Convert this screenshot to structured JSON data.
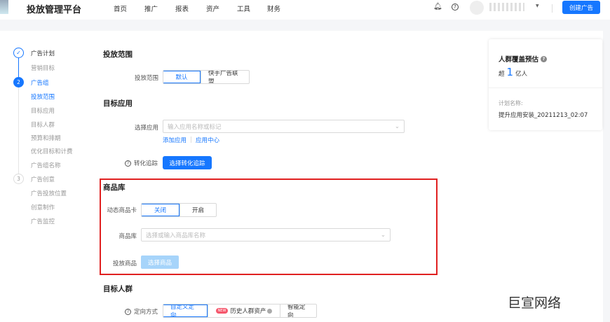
{
  "header": {
    "title": "投放管理平台",
    "nav": [
      "首页",
      "推广",
      "报表",
      "资产",
      "工具",
      "财务"
    ],
    "create_button": "创建广告",
    "icons": [
      "bell-icon",
      "help-icon"
    ]
  },
  "steps": [
    {
      "num": "✓",
      "label": "广告计划",
      "state": "done",
      "subs": [
        "营销目标"
      ]
    },
    {
      "num": "2",
      "label": "广告组",
      "state": "active",
      "subs": [
        "投放范围",
        "目标应用",
        "目标人群",
        "预算和排期",
        "优化目标和计费",
        "广告组名称"
      ],
      "active_sub": "投放范围"
    },
    {
      "num": "3",
      "label": "广告创意",
      "state": "todo",
      "subs": [
        "广告投放位置",
        "创意制作",
        "广告监控"
      ]
    }
  ],
  "scope": {
    "title": "投放范围",
    "label": "投放范围",
    "options": [
      "默认",
      "快手广告联盟"
    ],
    "selected": "默认"
  },
  "app": {
    "title": "目标应用",
    "label": "选择应用",
    "placeholder": "输入应用名称或标记",
    "links": [
      "添加应用",
      "应用中心"
    ],
    "track_label": "转化追踪",
    "track_button": "选择转化追踪"
  },
  "product": {
    "title": "商品库",
    "card_label": "动态商品卡",
    "card_options": [
      "关闭",
      "开启"
    ],
    "card_selected": "关闭",
    "lib_label": "商品库",
    "lib_placeholder": "选择或输入商品库名称",
    "put_label": "投放商品",
    "put_button": "选择商品",
    "highlight_color": "#e02020"
  },
  "audience": {
    "title": "目标人群",
    "label": "定向方式",
    "options": [
      "自定义定向",
      "历史人群资产",
      "智能定向"
    ],
    "selected": "自定义定向",
    "new_badge": "NEW"
  },
  "panel": {
    "title": "人群覆盖预估",
    "prefix": "超",
    "number": "1",
    "unit": "亿人",
    "plan_label": "计划名称:",
    "plan_name": "提升应用安装_20211213_02:07"
  },
  "watermark": "巨宣网络"
}
